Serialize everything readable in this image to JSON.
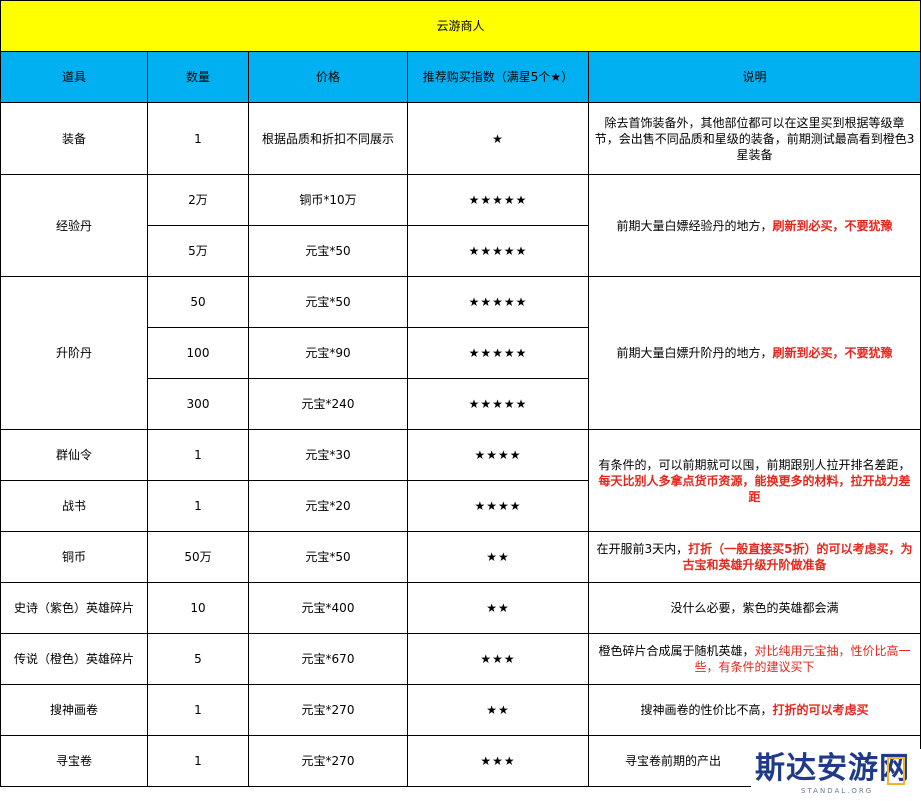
{
  "title": "云游商人",
  "headers": [
    "道具",
    "数量",
    "价格",
    "推荐购买指数（满星5个★）",
    "说明"
  ],
  "rows": {
    "equip": {
      "item": "装备",
      "qty": "1",
      "price": "根据品质和折扣不同展示",
      "stars": "★",
      "note": "除去首饰装备外，其他部位都可以在这里买到根据等级章节，会出售不同品质和星级的装备，前期测试最高看到橙色3星装备"
    },
    "exp": {
      "item": "经验丹",
      "sub": [
        {
          "qty": "2万",
          "price": "铜币*10万",
          "stars": "★★★★★"
        },
        {
          "qty": "5万",
          "price": "元宝*50",
          "stars": "★★★★★"
        }
      ],
      "note_plain": "前期大量白嫖经验丹的地方，",
      "note_red": "刷新到必买，不要犹豫"
    },
    "rank": {
      "item": "升阶丹",
      "sub": [
        {
          "qty": "50",
          "price": "元宝*50",
          "stars": "★★★★★"
        },
        {
          "qty": "100",
          "price": "元宝*90",
          "stars": "★★★★★"
        },
        {
          "qty": "300",
          "price": "元宝*240",
          "stars": "★★★★★"
        }
      ],
      "note_plain": "前期大量白嫖升阶丹的地方，",
      "note_red": "刷新到必买，不要犹豫"
    },
    "qxl": {
      "item": "群仙令",
      "qty": "1",
      "price": "元宝*30",
      "stars": "★★★★"
    },
    "zs": {
      "item": "战书",
      "qty": "1",
      "price": "元宝*20",
      "stars": "★★★★"
    },
    "qxl_note": {
      "plain": "有条件的，可以前期就可以囤，前期跟别人拉开排名差距，",
      "red": "每天比别人多拿点货币资源，能换更多的材料，拉开战力差距"
    },
    "coin": {
      "item": "铜币",
      "qty": "50万",
      "price": "元宝*50",
      "stars": "★★",
      "note_plain": "在开服前3天内，",
      "note_red": "打折（一般直接买5折）的可以考虑买，为古宝和英雄升级升阶做准备"
    },
    "epic": {
      "item": "史诗（紫色）英雄碎片",
      "qty": "10",
      "price": "元宝*400",
      "stars": "★★",
      "note": "没什么必要，紫色的英雄都会满"
    },
    "legend": {
      "item": "传说（橙色）英雄碎片",
      "qty": "5",
      "price": "元宝*670",
      "stars": "★★★",
      "note_plain": "橙色碎片合成属于随机英雄，",
      "note_red": "对比纯用元宝抽，性价比高一些，有条件的建议买下"
    },
    "scroll": {
      "item": "搜神画卷",
      "qty": "1",
      "price": "元宝*270",
      "stars": "★★",
      "note_plain": "搜神画卷的性价比不高，",
      "note_red": "打折的可以考虑买"
    },
    "treasure": {
      "item": "寻宝卷",
      "qty": "1",
      "price": "元宝*270",
      "stars": "★★★",
      "note": "寻宝卷前期的产出"
    }
  },
  "watermark": {
    "text": "斯达安游网",
    "sub": "STANDAL.ORG"
  }
}
